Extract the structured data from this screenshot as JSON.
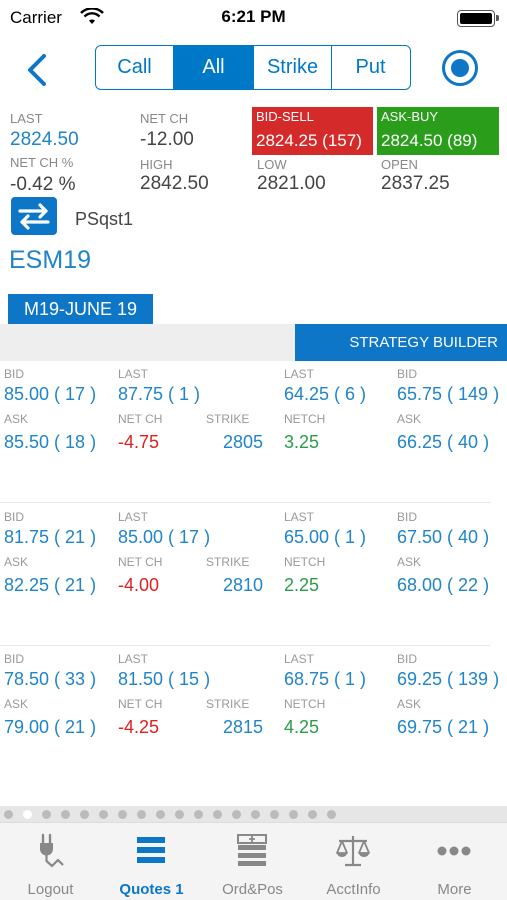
{
  "status_bar": {
    "carrier": "Carrier",
    "time": "6:21 PM"
  },
  "nav": {
    "segments": [
      "Call",
      "All",
      "Strike",
      "Put"
    ],
    "selected_segment": "All"
  },
  "quote": {
    "last_label": "LAST",
    "last": "2824.50",
    "net_ch_label": "NET CH",
    "net_ch": "-12.00",
    "bid_sell_label": "BID-SELL",
    "bid_sell": "2824.25 (157)",
    "ask_buy_label": "ASK-BUY",
    "ask_buy": "2824.50 (89)",
    "net_ch_pct_label": "NET CH %",
    "net_ch_pct": "-0.42 %",
    "high_label": "HIGH",
    "high": "2842.50",
    "low_label": "LOW",
    "low": "2821.00",
    "open_label": "OPEN",
    "open": "2837.25"
  },
  "account": "PSqst1",
  "symbol": "ESM19",
  "expiry": "M19-JUNE 19",
  "strategy_builder": "STRATEGY BUILDER",
  "labels": {
    "bid": "BID",
    "last": "LAST",
    "ask": "ASK",
    "net_ch": "NET CH",
    "strike": "STRIKE",
    "netch": "NETCH"
  },
  "strikes": [
    {
      "call": {
        "bid": "85.00 ( 17 )",
        "last": "87.75 ( 1 )",
        "ask": "85.50 ( 18 )",
        "net_ch": "-4.75"
      },
      "strike": "2805",
      "put": {
        "last": "64.25 ( 6 )",
        "bid": "65.75 ( 149 )",
        "netch": "3.25",
        "ask": "66.25 ( 40 )"
      }
    },
    {
      "call": {
        "bid": "81.75 ( 21 )",
        "last": "85.00 ( 17 )",
        "ask": "82.25 ( 21 )",
        "net_ch": "-4.00"
      },
      "strike": "2810",
      "put": {
        "last": "65.00 ( 1 )",
        "bid": "67.50 ( 40 )",
        "netch": "2.25",
        "ask": "68.00 ( 22 )"
      }
    },
    {
      "call": {
        "bid": "78.50 ( 33 )",
        "last": "81.50 ( 15 )",
        "ask": "79.00 ( 21 )",
        "net_ch": "-4.25"
      },
      "strike": "2815",
      "put": {
        "last": "68.75 ( 1 )",
        "bid": "69.25 ( 139 )",
        "netch": "4.25",
        "ask": "69.75 ( 21 )"
      }
    }
  ],
  "pager": {
    "count": 18,
    "current": 2
  },
  "tabs": [
    {
      "label": "Logout",
      "icon": "plug-icon"
    },
    {
      "label": "Quotes 1",
      "icon": "list-icon"
    },
    {
      "label": "Ord&Pos",
      "icon": "orders-icon"
    },
    {
      "label": "AcctInfo",
      "icon": "scales-icon"
    },
    {
      "label": "More",
      "icon": "more-icon"
    }
  ],
  "active_tab": "Quotes 1",
  "colors": {
    "accent": "#0d76c6",
    "bid_sell": "#d42a2a",
    "ask_buy": "#2a9d1a",
    "negative": "#e02020",
    "positive": "#2a9d4a"
  }
}
